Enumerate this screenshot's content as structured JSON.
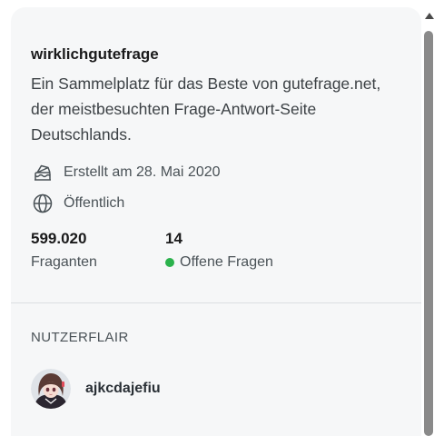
{
  "community": {
    "name": "wirklichgutefrage",
    "description": "Ein Sammelplatz für das Beste von gutefrage.net, der meistbesuchten Frage-Antwort-Seite Deutschlands.",
    "created": "Erstellt am 28. Mai 2020",
    "created_icon": "cake-icon",
    "visibility": "Öffentlich",
    "visibility_icon": "globe-icon"
  },
  "stats": {
    "members_value": "599.020",
    "members_label": "Fraganten",
    "online_value": "14",
    "online_label": "Offene Fragen",
    "online_color": "#2bb24c"
  },
  "flair": {
    "heading": "NUTZERFLAIR",
    "username": "ajkcdajefiu"
  }
}
